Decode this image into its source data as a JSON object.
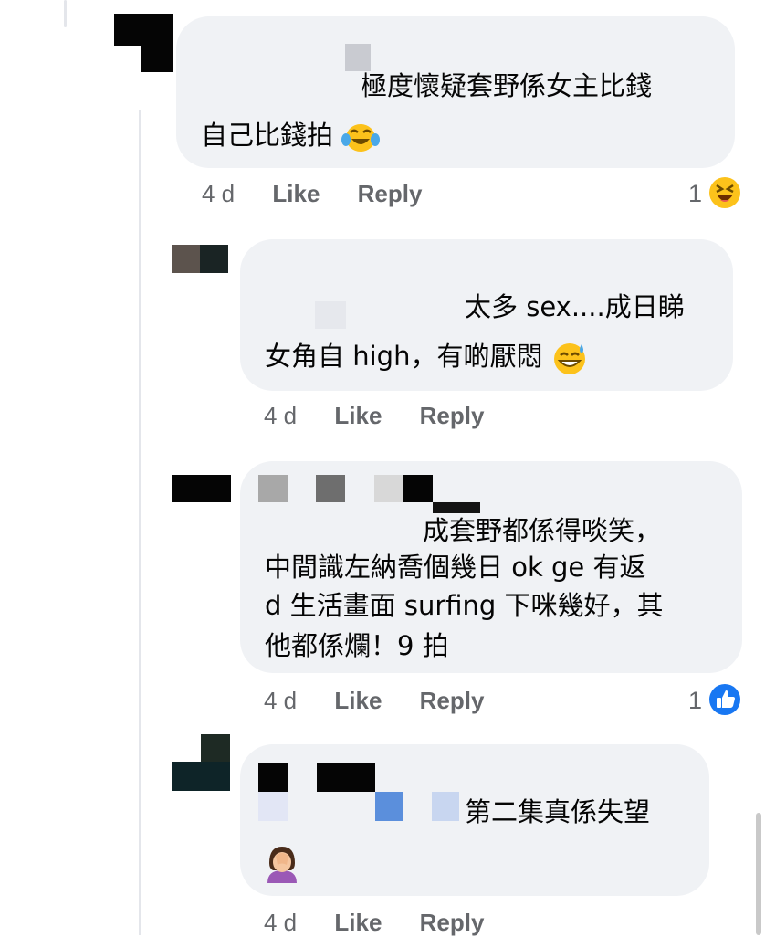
{
  "comments": [
    {
      "lines": [
        "極度懷疑套野係女主比錢",
        "自己比錢拍"
      ],
      "time": "4 d",
      "like": "Like",
      "reply": "Reply",
      "reaction_count": "1",
      "reaction_icon": "laughing-face-icon",
      "inline_emoji": "tears-of-joy-emoji"
    },
    {
      "lines": [
        "太多 sex....成日睇",
        "女角自 high，有啲厭悶"
      ],
      "time": "4 d",
      "like": "Like",
      "reply": "Reply",
      "inline_emoji": "sweat-smile-emoji"
    },
    {
      "lines": [
        "成套野都係得啖笑，",
        "中間識左納喬個幾日 ok ge 有返",
        "d 生活畫面 surfing 下咪幾好，其",
        "他都係爛！9 拍"
      ],
      "time": "4 d",
      "like": "Like",
      "reply": "Reply",
      "reaction_count": "1",
      "reaction_icon": "like-thumb-icon"
    },
    {
      "lines": [
        "第二集真係失望"
      ],
      "time": "4 d",
      "like": "Like",
      "reply": "Reply",
      "inline_emoji": "facepalm-woman-emoji"
    }
  ],
  "colors": {
    "bubble": "#f0f2f5",
    "meta_text": "#65676b",
    "like_blue": "#1877f2",
    "emoji_yellow": "#fcc21b"
  }
}
